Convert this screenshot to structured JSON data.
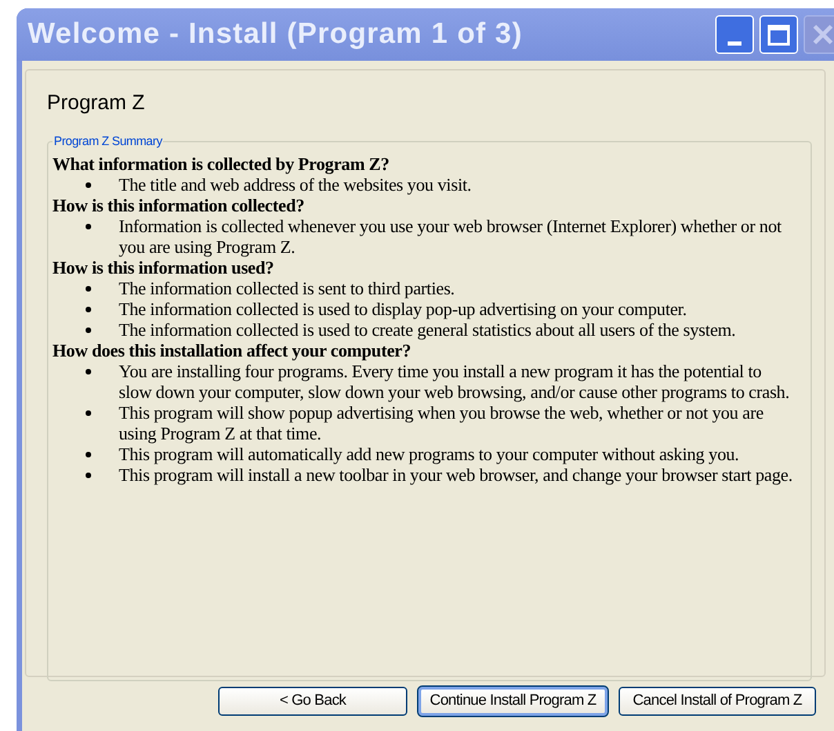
{
  "window": {
    "title": "Welcome - Install (Program 1 of 3)"
  },
  "heading": "Program Z",
  "summary": {
    "legend": "Program Z Summary",
    "sections": [
      {
        "question": "What information is collected by Program Z?",
        "bullets": [
          "The title and web address of the websites you visit."
        ]
      },
      {
        "question": "How is this information collected?",
        "bullets": [
          "Information is collected whenever you use your web browser (Internet Explorer) whether or not you are using Program Z."
        ]
      },
      {
        "question": "How is this information used?",
        "bullets": [
          "The information collected is sent to third parties.",
          "The information collected is used to display pop-up advertising on your computer.",
          "The information collected is used to create general statistics about all users of the system."
        ]
      },
      {
        "question": "How does this installation affect your computer?",
        "bullets": [
          "You are installing four programs. Every time you install a new program it has the potential to slow down your computer, slow down your web browsing, and/or cause other programs to crash.",
          "This program will show popup advertising when you browse the web, whether or not you are using Program Z at that time.",
          "This program will automatically add new programs to your computer without asking you.",
          "This program will install a new toolbar in your web browser, and change your browser start page."
        ]
      }
    ]
  },
  "buttons": [
    {
      "label": "< Go Back",
      "default": false
    },
    {
      "label": "Continue Install Program Z",
      "default": true
    },
    {
      "label": "Cancel Install of Program Z",
      "default": false
    }
  ]
}
